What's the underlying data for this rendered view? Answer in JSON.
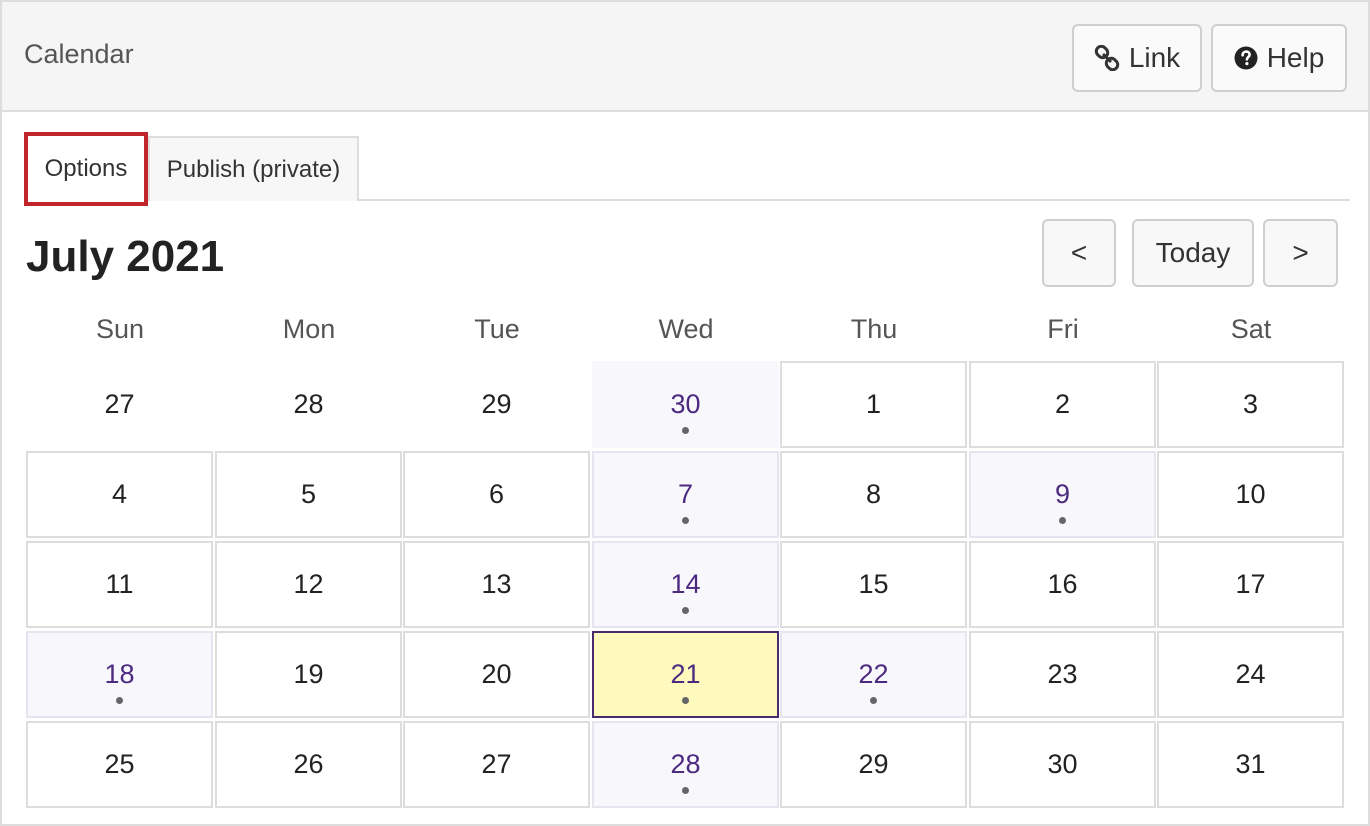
{
  "header": {
    "title": "Calendar",
    "link_label": "Link",
    "help_label": "Help"
  },
  "tabs": [
    {
      "label": "Options",
      "highlighted": true
    },
    {
      "label": "Publish (private)"
    }
  ],
  "calendar": {
    "month_title": "July 2021",
    "nav": {
      "prev_label": "<",
      "today_label": "Today",
      "next_label": ">"
    },
    "weekdays": [
      "Sun",
      "Mon",
      "Tue",
      "Wed",
      "Thu",
      "Fri",
      "Sat"
    ],
    "weeks": [
      [
        {
          "day": "27"
        },
        {
          "day": "28"
        },
        {
          "day": "29"
        },
        {
          "day": "30",
          "event": true
        },
        {
          "day": "1"
        },
        {
          "day": "2"
        },
        {
          "day": "3"
        }
      ],
      [
        {
          "day": "4"
        },
        {
          "day": "5"
        },
        {
          "day": "6"
        },
        {
          "day": "7",
          "event": true
        },
        {
          "day": "8"
        },
        {
          "day": "9",
          "event": true
        },
        {
          "day": "10"
        }
      ],
      [
        {
          "day": "11"
        },
        {
          "day": "12"
        },
        {
          "day": "13"
        },
        {
          "day": "14",
          "event": true
        },
        {
          "day": "15"
        },
        {
          "day": "16"
        },
        {
          "day": "17"
        }
      ],
      [
        {
          "day": "18",
          "event": true
        },
        {
          "day": "19"
        },
        {
          "day": "20"
        },
        {
          "day": "21",
          "event": true,
          "today": true
        },
        {
          "day": "22",
          "event": true
        },
        {
          "day": "23"
        },
        {
          "day": "24"
        }
      ],
      [
        {
          "day": "25"
        },
        {
          "day": "26"
        },
        {
          "day": "27"
        },
        {
          "day": "28",
          "event": true
        },
        {
          "day": "29"
        },
        {
          "day": "30"
        },
        {
          "day": "31"
        }
      ]
    ]
  },
  "colors": {
    "tab_highlight": "#c0252b",
    "event_day_text": "#4b2a80",
    "today_bg": "#fef9bd",
    "today_border": "#4a2c6e"
  }
}
